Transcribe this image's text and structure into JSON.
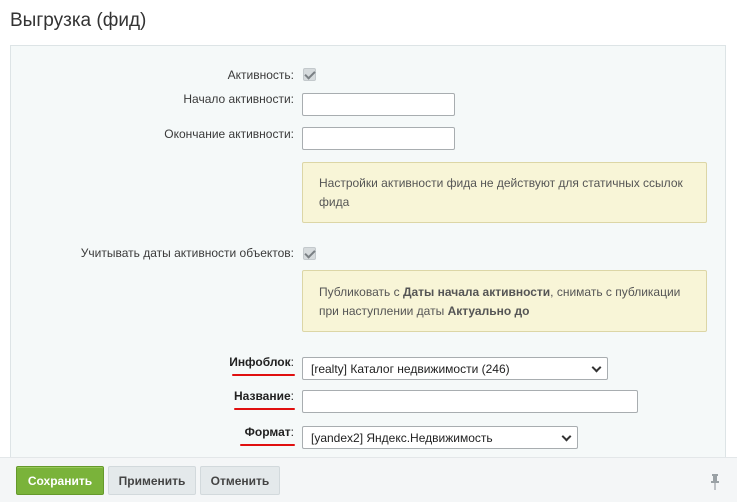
{
  "page": {
    "title": "Выгрузка (фид)"
  },
  "form": {
    "active_label": "Активность:",
    "active_checked": true,
    "start_label": "Начало активности:",
    "start_value": "",
    "end_label": "Окончание активности:",
    "end_value": "",
    "note_static": "Настройки активности фида не действуют для статичных ссылок фида",
    "dates_label": "Учитывать даты активности объектов:",
    "dates_checked": true,
    "note_publish": {
      "part1": "Публиковать с ",
      "bold1": "Даты начала активности",
      "part2": ", снимать с публикации при наступлении даты ",
      "bold2": "Актуально до"
    },
    "iblock_label": "Инфоблок",
    "iblock_value": "[realty] Каталог недвижимости (246)",
    "name_label": "Название",
    "name_value": "",
    "format_label": "Формат",
    "format_value": "[yandex2] Яндекс.Недвижимость",
    "colon": ":"
  },
  "footer": {
    "save_label": "Сохранить",
    "apply_label": "Применить",
    "cancel_label": "Отменить"
  },
  "colors": {
    "accent_green": "#7ab33a",
    "note_bg": "#f8f5d7",
    "underline_red": "#e01010"
  },
  "icons": [
    "calendar-icon",
    "chevron-down-icon",
    "pin-icon",
    "checkmark-icon"
  ]
}
